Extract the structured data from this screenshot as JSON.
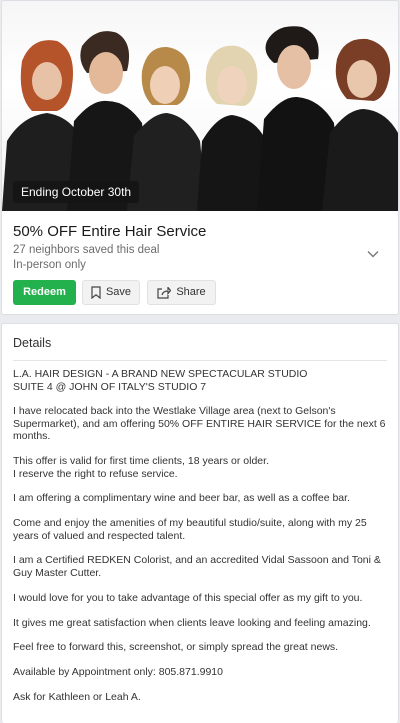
{
  "deal": {
    "badge": "Ending October 30th",
    "title": "50% OFF Entire Hair Service",
    "saved_text": "27 neighbors saved this deal",
    "mode": "In-person only",
    "actions": {
      "redeem_label": "Redeem",
      "save_label": "Save",
      "share_label": "Share"
    }
  },
  "details": {
    "heading": "Details",
    "paragraphs": [
      "L.A. HAIR DESIGN - A BRAND NEW SPECTACULAR STUDIO\nSUITE 4 @ JOHN OF ITALY'S STUDIO 7",
      "I have relocated back into the Westlake Village area (next to Gelson's Supermarket), and am offering 50% OFF ENTIRE HAIR SERVICE for the next 6 months.",
      "This offer is valid for first time clients, 18 years or older.\nI reserve the right to refuse service.",
      "I am offering a complimentary wine and beer bar, as well as a coffee bar.",
      "Come and enjoy the amenities of my beautiful studio/suite, along with my 25 years of valued and respected talent.",
      "I am a Certified REDKEN Colorist, and an accredited Vidal Sassoon and Toni & Guy Master Cutter.",
      "I would love for you to take advantage of this special offer as my gift to you.",
      "It gives me great satisfaction when clients leave looking and feeling amazing.",
      "Feel free to forward this, screenshot, or simply spread the great news.",
      "Available by Appointment only: 805.871.9910",
      "Ask for Kathleen or Leah A."
    ]
  },
  "colors": {
    "redeem": "#23b14d",
    "page_background": "#e9ebee"
  }
}
